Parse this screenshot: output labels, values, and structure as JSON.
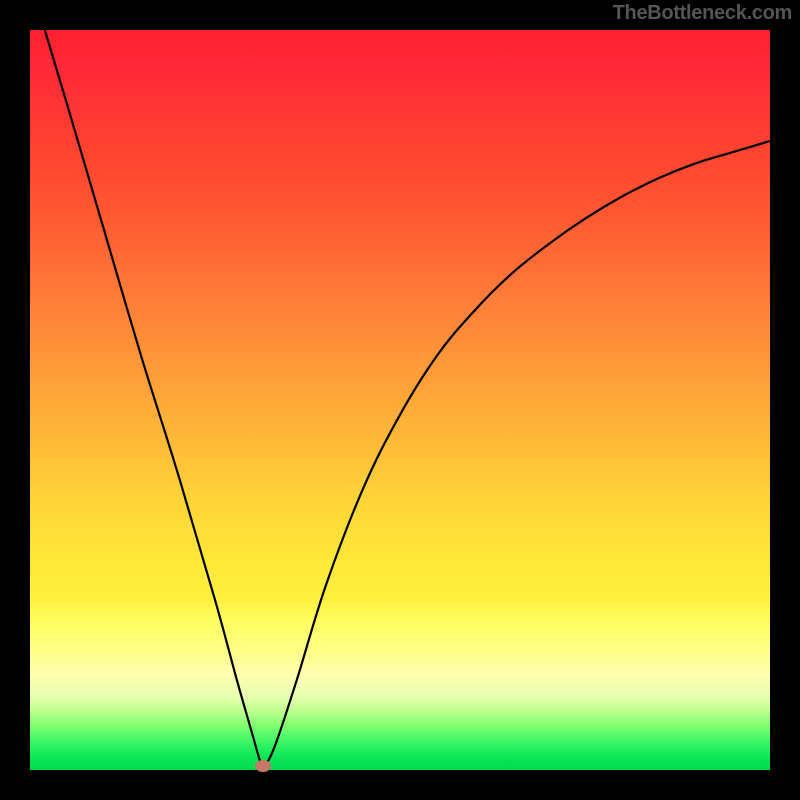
{
  "watermark": "TheBottleneck.com",
  "chart_data": {
    "type": "line",
    "title": "",
    "xlabel": "",
    "ylabel": "",
    "xlim": [
      0,
      1
    ],
    "ylim": [
      0,
      1
    ],
    "series": [
      {
        "name": "curve",
        "x": [
          0.02,
          0.05,
          0.1,
          0.15,
          0.2,
          0.25,
          0.28,
          0.3,
          0.31,
          0.315,
          0.33,
          0.36,
          0.4,
          0.45,
          0.5,
          0.55,
          0.6,
          0.65,
          0.7,
          0.75,
          0.8,
          0.85,
          0.9,
          0.95,
          1.0
        ],
        "y": [
          1.0,
          0.9,
          0.73,
          0.56,
          0.4,
          0.23,
          0.12,
          0.05,
          0.015,
          0.005,
          0.03,
          0.12,
          0.25,
          0.38,
          0.48,
          0.56,
          0.62,
          0.67,
          0.71,
          0.745,
          0.775,
          0.8,
          0.82,
          0.835,
          0.85
        ]
      }
    ],
    "marker": {
      "x": 0.315,
      "y": 0.005
    },
    "gradient": {
      "top_color": "#ff2030",
      "bottom_color": "#00d850"
    }
  }
}
